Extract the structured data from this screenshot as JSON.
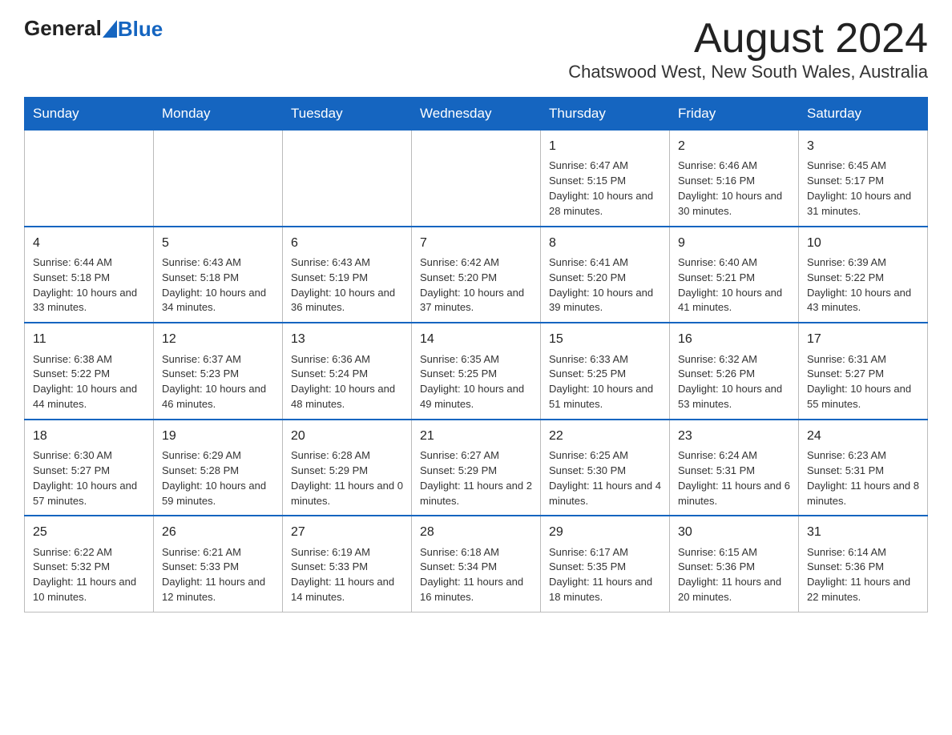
{
  "header": {
    "logo_general": "General",
    "logo_blue": "Blue",
    "month_title": "August 2024",
    "subtitle": "Chatswood West, New South Wales, Australia"
  },
  "days_of_week": [
    "Sunday",
    "Monday",
    "Tuesday",
    "Wednesday",
    "Thursday",
    "Friday",
    "Saturday"
  ],
  "weeks": [
    [
      {
        "day": "",
        "info": ""
      },
      {
        "day": "",
        "info": ""
      },
      {
        "day": "",
        "info": ""
      },
      {
        "day": "",
        "info": ""
      },
      {
        "day": "1",
        "info": "Sunrise: 6:47 AM\nSunset: 5:15 PM\nDaylight: 10 hours and 28 minutes."
      },
      {
        "day": "2",
        "info": "Sunrise: 6:46 AM\nSunset: 5:16 PM\nDaylight: 10 hours and 30 minutes."
      },
      {
        "day": "3",
        "info": "Sunrise: 6:45 AM\nSunset: 5:17 PM\nDaylight: 10 hours and 31 minutes."
      }
    ],
    [
      {
        "day": "4",
        "info": "Sunrise: 6:44 AM\nSunset: 5:18 PM\nDaylight: 10 hours and 33 minutes."
      },
      {
        "day": "5",
        "info": "Sunrise: 6:43 AM\nSunset: 5:18 PM\nDaylight: 10 hours and 34 minutes."
      },
      {
        "day": "6",
        "info": "Sunrise: 6:43 AM\nSunset: 5:19 PM\nDaylight: 10 hours and 36 minutes."
      },
      {
        "day": "7",
        "info": "Sunrise: 6:42 AM\nSunset: 5:20 PM\nDaylight: 10 hours and 37 minutes."
      },
      {
        "day": "8",
        "info": "Sunrise: 6:41 AM\nSunset: 5:20 PM\nDaylight: 10 hours and 39 minutes."
      },
      {
        "day": "9",
        "info": "Sunrise: 6:40 AM\nSunset: 5:21 PM\nDaylight: 10 hours and 41 minutes."
      },
      {
        "day": "10",
        "info": "Sunrise: 6:39 AM\nSunset: 5:22 PM\nDaylight: 10 hours and 43 minutes."
      }
    ],
    [
      {
        "day": "11",
        "info": "Sunrise: 6:38 AM\nSunset: 5:22 PM\nDaylight: 10 hours and 44 minutes."
      },
      {
        "day": "12",
        "info": "Sunrise: 6:37 AM\nSunset: 5:23 PM\nDaylight: 10 hours and 46 minutes."
      },
      {
        "day": "13",
        "info": "Sunrise: 6:36 AM\nSunset: 5:24 PM\nDaylight: 10 hours and 48 minutes."
      },
      {
        "day": "14",
        "info": "Sunrise: 6:35 AM\nSunset: 5:25 PM\nDaylight: 10 hours and 49 minutes."
      },
      {
        "day": "15",
        "info": "Sunrise: 6:33 AM\nSunset: 5:25 PM\nDaylight: 10 hours and 51 minutes."
      },
      {
        "day": "16",
        "info": "Sunrise: 6:32 AM\nSunset: 5:26 PM\nDaylight: 10 hours and 53 minutes."
      },
      {
        "day": "17",
        "info": "Sunrise: 6:31 AM\nSunset: 5:27 PM\nDaylight: 10 hours and 55 minutes."
      }
    ],
    [
      {
        "day": "18",
        "info": "Sunrise: 6:30 AM\nSunset: 5:27 PM\nDaylight: 10 hours and 57 minutes."
      },
      {
        "day": "19",
        "info": "Sunrise: 6:29 AM\nSunset: 5:28 PM\nDaylight: 10 hours and 59 minutes."
      },
      {
        "day": "20",
        "info": "Sunrise: 6:28 AM\nSunset: 5:29 PM\nDaylight: 11 hours and 0 minutes."
      },
      {
        "day": "21",
        "info": "Sunrise: 6:27 AM\nSunset: 5:29 PM\nDaylight: 11 hours and 2 minutes."
      },
      {
        "day": "22",
        "info": "Sunrise: 6:25 AM\nSunset: 5:30 PM\nDaylight: 11 hours and 4 minutes."
      },
      {
        "day": "23",
        "info": "Sunrise: 6:24 AM\nSunset: 5:31 PM\nDaylight: 11 hours and 6 minutes."
      },
      {
        "day": "24",
        "info": "Sunrise: 6:23 AM\nSunset: 5:31 PM\nDaylight: 11 hours and 8 minutes."
      }
    ],
    [
      {
        "day": "25",
        "info": "Sunrise: 6:22 AM\nSunset: 5:32 PM\nDaylight: 11 hours and 10 minutes."
      },
      {
        "day": "26",
        "info": "Sunrise: 6:21 AM\nSunset: 5:33 PM\nDaylight: 11 hours and 12 minutes."
      },
      {
        "day": "27",
        "info": "Sunrise: 6:19 AM\nSunset: 5:33 PM\nDaylight: 11 hours and 14 minutes."
      },
      {
        "day": "28",
        "info": "Sunrise: 6:18 AM\nSunset: 5:34 PM\nDaylight: 11 hours and 16 minutes."
      },
      {
        "day": "29",
        "info": "Sunrise: 6:17 AM\nSunset: 5:35 PM\nDaylight: 11 hours and 18 minutes."
      },
      {
        "day": "30",
        "info": "Sunrise: 6:15 AM\nSunset: 5:36 PM\nDaylight: 11 hours and 20 minutes."
      },
      {
        "day": "31",
        "info": "Sunrise: 6:14 AM\nSunset: 5:36 PM\nDaylight: 11 hours and 22 minutes."
      }
    ]
  ]
}
